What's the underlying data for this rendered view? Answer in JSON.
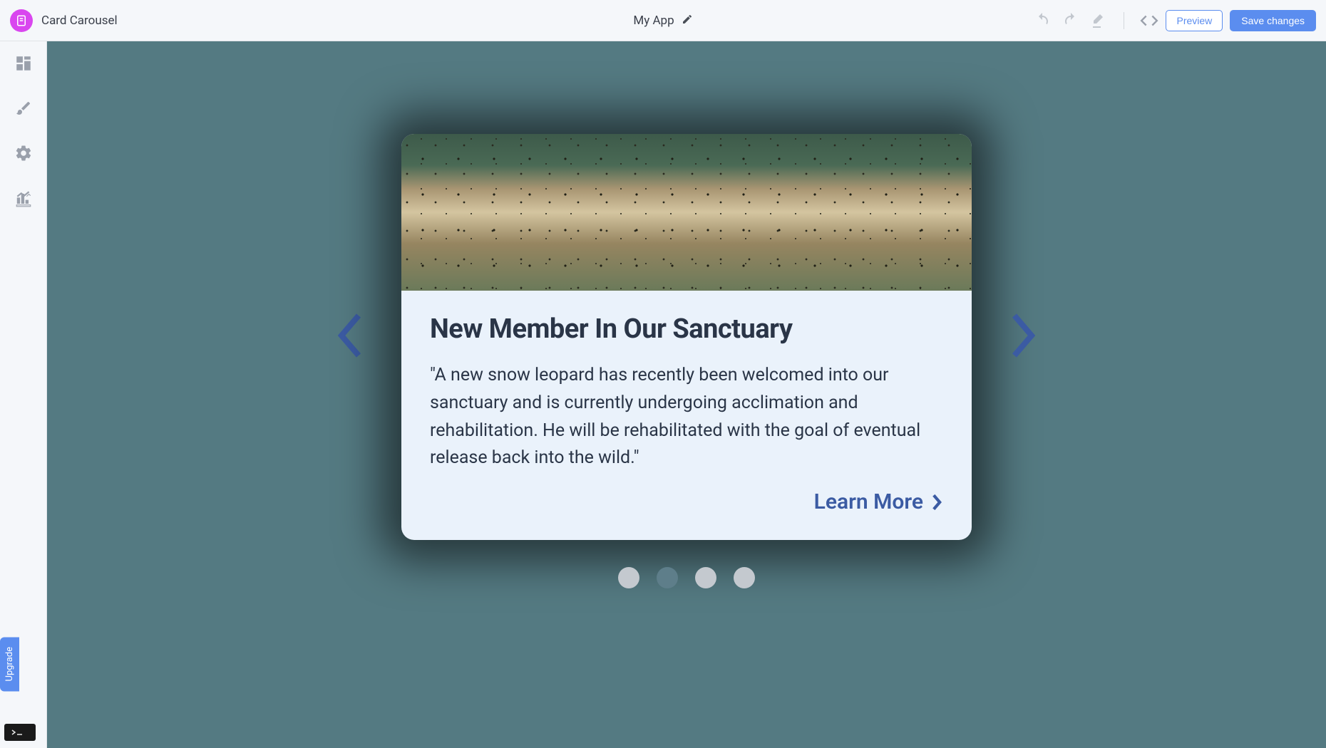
{
  "topbar": {
    "page_name": "Card Carousel",
    "app_title": "My App",
    "preview_label": "Preview",
    "save_label": "Save changes"
  },
  "sidebar": {
    "upgrade_label": "Upgrade"
  },
  "carousel": {
    "card": {
      "title": "New Member In Our Sanctuary",
      "body": "\"A new snow leopard has recently been welcomed into our sanctuary and is currently undergoing acclimation and rehabilitation. He will be rehabilitated with the goal of eventual release back into the wild.\"",
      "link_label": "Learn More"
    },
    "total_slides": 4,
    "active_index": 1
  }
}
